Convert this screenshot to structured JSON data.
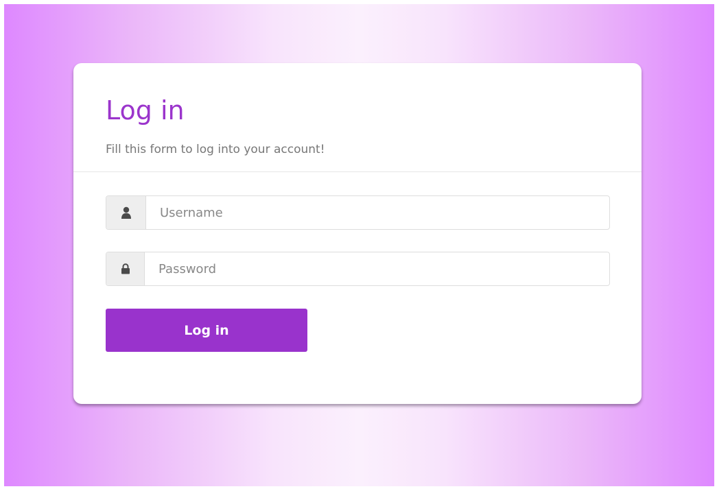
{
  "login": {
    "title": "Log in",
    "subtitle": "Fill this form to log into your account!",
    "username": {
      "placeholder": "Username",
      "value": "",
      "icon": "user-icon"
    },
    "password": {
      "placeholder": "Password",
      "value": "",
      "icon": "lock-icon"
    },
    "submit_label": "Log in"
  },
  "colors": {
    "accent": "#9933cc",
    "title": "#9b35cc",
    "background_edge": "#de88ff",
    "background_center": "#fbf0fd"
  }
}
